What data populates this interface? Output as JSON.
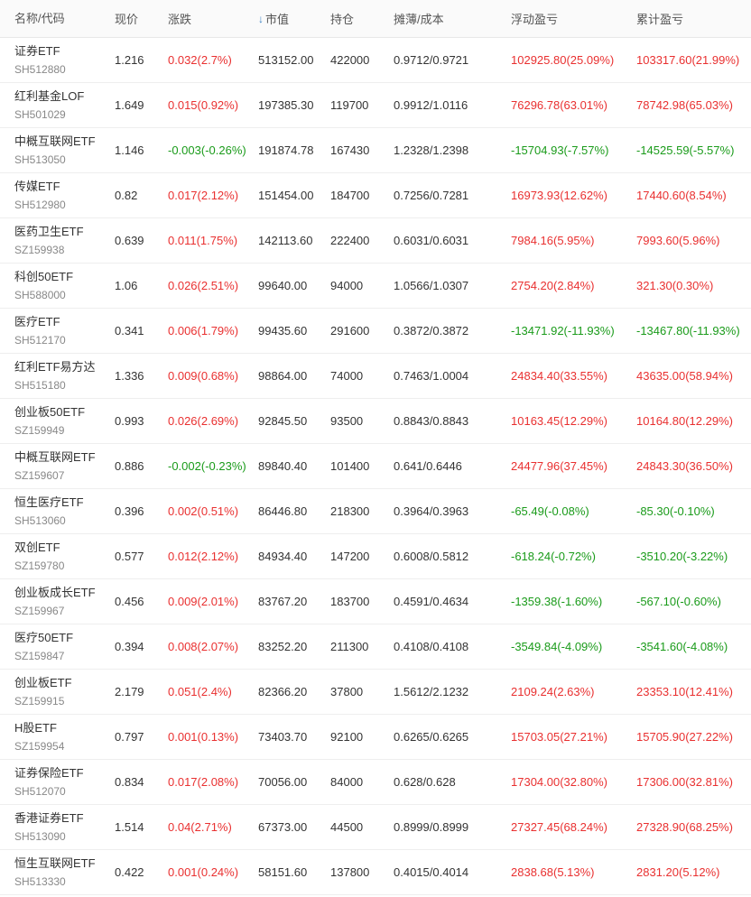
{
  "colors": {
    "positive": "#e93030",
    "negative": "#1a9b1a",
    "sort_arrow": "#3b82c4"
  },
  "header": {
    "name_code": "名称/代码",
    "price": "现价",
    "change": "涨跌",
    "market_value_icon": "arrow-down-icon",
    "market_value": "市值",
    "position": "持仓",
    "cost": "摊薄/成本",
    "floating_pnl": "浮动盈亏",
    "cumulative_pnl": "累计盈亏"
  },
  "rows": [
    {
      "name": "证券ETF",
      "code": "SH512880",
      "price": "1.216",
      "change": "0.032(2.7%)",
      "mv": "513152.00",
      "pos": "422000",
      "cost": "0.9712/0.9721",
      "float": "102925.80(25.09%)",
      "cum": "103317.60(21.99%)"
    },
    {
      "name": "红利基金LOF",
      "code": "SH501029",
      "price": "1.649",
      "change": "0.015(0.92%)",
      "mv": "197385.30",
      "pos": "119700",
      "cost": "0.9912/1.0116",
      "float": "76296.78(63.01%)",
      "cum": "78742.98(65.03%)"
    },
    {
      "name": "中概互联网ETF",
      "code": "SH513050",
      "price": "1.146",
      "change": "-0.003(-0.26%)",
      "mv": "191874.78",
      "pos": "167430",
      "cost": "1.2328/1.2398",
      "float": "-15704.93(-7.57%)",
      "cum": "-14525.59(-5.57%)"
    },
    {
      "name": "传媒ETF",
      "code": "SH512980",
      "price": "0.82",
      "change": "0.017(2.12%)",
      "mv": "151454.00",
      "pos": "184700",
      "cost": "0.7256/0.7281",
      "float": "16973.93(12.62%)",
      "cum": "17440.60(8.54%)"
    },
    {
      "name": "医药卫生ETF",
      "code": "SZ159938",
      "price": "0.639",
      "change": "0.011(1.75%)",
      "mv": "142113.60",
      "pos": "222400",
      "cost": "0.6031/0.6031",
      "float": "7984.16(5.95%)",
      "cum": "7993.60(5.96%)"
    },
    {
      "name": "科创50ETF",
      "code": "SH588000",
      "price": "1.06",
      "change": "0.026(2.51%)",
      "mv": "99640.00",
      "pos": "94000",
      "cost": "1.0566/1.0307",
      "float": "2754.20(2.84%)",
      "cum": "321.30(0.30%)"
    },
    {
      "name": "医疗ETF",
      "code": "SH512170",
      "price": "0.341",
      "change": "0.006(1.79%)",
      "mv": "99435.60",
      "pos": "291600",
      "cost": "0.3872/0.3872",
      "float": "-13471.92(-11.93%)",
      "cum": "-13467.80(-11.93%)"
    },
    {
      "name": "红利ETF易方达",
      "code": "SH515180",
      "price": "1.336",
      "change": "0.009(0.68%)",
      "mv": "98864.00",
      "pos": "74000",
      "cost": "0.7463/1.0004",
      "float": "24834.40(33.55%)",
      "cum": "43635.00(58.94%)"
    },
    {
      "name": "创业板50ETF",
      "code": "SZ159949",
      "price": "0.993",
      "change": "0.026(2.69%)",
      "mv": "92845.50",
      "pos": "93500",
      "cost": "0.8843/0.8843",
      "float": "10163.45(12.29%)",
      "cum": "10164.80(12.29%)"
    },
    {
      "name": "中概互联网ETF",
      "code": "SZ159607",
      "price": "0.886",
      "change": "-0.002(-0.23%)",
      "mv": "89840.40",
      "pos": "101400",
      "cost": "0.641/0.6446",
      "float": "24477.96(37.45%)",
      "cum": "24843.30(36.50%)"
    },
    {
      "name": "恒生医疗ETF",
      "code": "SH513060",
      "price": "0.396",
      "change": "0.002(0.51%)",
      "mv": "86446.80",
      "pos": "218300",
      "cost": "0.3964/0.3963",
      "float": "-65.49(-0.08%)",
      "cum": "-85.30(-0.10%)"
    },
    {
      "name": "双创ETF",
      "code": "SZ159780",
      "price": "0.577",
      "change": "0.012(2.12%)",
      "mv": "84934.40",
      "pos": "147200",
      "cost": "0.6008/0.5812",
      "float": "-618.24(-0.72%)",
      "cum": "-3510.20(-3.22%)"
    },
    {
      "name": "创业板成长ETF",
      "code": "SZ159967",
      "price": "0.456",
      "change": "0.009(2.01%)",
      "mv": "83767.20",
      "pos": "183700",
      "cost": "0.4591/0.4634",
      "float": "-1359.38(-1.60%)",
      "cum": "-567.10(-0.60%)"
    },
    {
      "name": "医疗50ETF",
      "code": "SZ159847",
      "price": "0.394",
      "change": "0.008(2.07%)",
      "mv": "83252.20",
      "pos": "211300",
      "cost": "0.4108/0.4108",
      "float": "-3549.84(-4.09%)",
      "cum": "-3541.60(-4.08%)"
    },
    {
      "name": "创业板ETF",
      "code": "SZ159915",
      "price": "2.179",
      "change": "0.051(2.4%)",
      "mv": "82366.20",
      "pos": "37800",
      "cost": "1.5612/2.1232",
      "float": "2109.24(2.63%)",
      "cum": "23353.10(12.41%)"
    },
    {
      "name": "H股ETF",
      "code": "SZ159954",
      "price": "0.797",
      "change": "0.001(0.13%)",
      "mv": "73403.70",
      "pos": "92100",
      "cost": "0.6265/0.6265",
      "float": "15703.05(27.21%)",
      "cum": "15705.90(27.22%)"
    },
    {
      "name": "证券保险ETF",
      "code": "SH512070",
      "price": "0.834",
      "change": "0.017(2.08%)",
      "mv": "70056.00",
      "pos": "84000",
      "cost": "0.628/0.628",
      "float": "17304.00(32.80%)",
      "cum": "17306.00(32.81%)"
    },
    {
      "name": "香港证券ETF",
      "code": "SH513090",
      "price": "1.514",
      "change": "0.04(2.71%)",
      "mv": "67373.00",
      "pos": "44500",
      "cost": "0.8999/0.8999",
      "float": "27327.45(68.24%)",
      "cum": "27328.90(68.25%)"
    },
    {
      "name": "恒生互联网ETF",
      "code": "SH513330",
      "price": "0.422",
      "change": "0.001(0.24%)",
      "mv": "58151.60",
      "pos": "137800",
      "cost": "0.4015/0.4014",
      "float": "2838.68(5.13%)",
      "cum": "2831.20(5.12%)"
    }
  ]
}
